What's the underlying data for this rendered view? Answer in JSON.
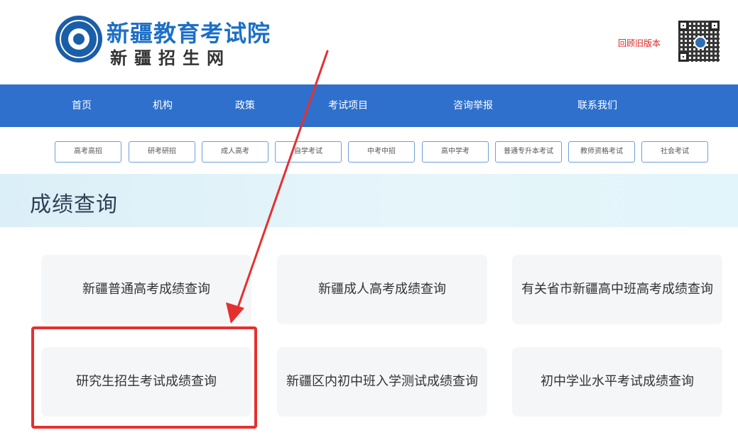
{
  "header": {
    "site_title": "新疆教育考试院",
    "site_subtitle": "新疆招生网",
    "old_version_link": "回顾旧版本"
  },
  "nav": {
    "items": [
      {
        "label": "首页"
      },
      {
        "label": "机构"
      },
      {
        "label": "政策"
      },
      {
        "label": "考试项目"
      },
      {
        "label": "咨询举报"
      },
      {
        "label": "联系我们"
      }
    ]
  },
  "subnav": {
    "items": [
      {
        "label": "高考高招"
      },
      {
        "label": "研考研招"
      },
      {
        "label": "成人高考"
      },
      {
        "label": "自学考试"
      },
      {
        "label": "中考中招"
      },
      {
        "label": "高中学考"
      },
      {
        "label": "普通专升本考试"
      },
      {
        "label": "教师资格考试"
      },
      {
        "label": "社会考试"
      }
    ]
  },
  "banner": {
    "title": "成绩查询"
  },
  "cards": [
    {
      "label": "新疆普通高考成绩查询"
    },
    {
      "label": "新疆成人高考成绩查询"
    },
    {
      "label": "有关省市新疆高中班高考成绩查询"
    },
    {
      "label": "研究生招生考试成绩查询"
    },
    {
      "label": "新疆区内初中班入学测试成绩查询"
    },
    {
      "label": "初中学业水平考试成绩查询"
    }
  ],
  "annotation": {
    "arrow_color": "#e53030",
    "highlighted_card": "研究生招生考试成绩查询"
  },
  "colors": {
    "nav_bg": "#2e70cc",
    "brand_blue": "#1d6fc6",
    "card_bg": "#f5f6f8",
    "highlight_red": "#e53030"
  }
}
